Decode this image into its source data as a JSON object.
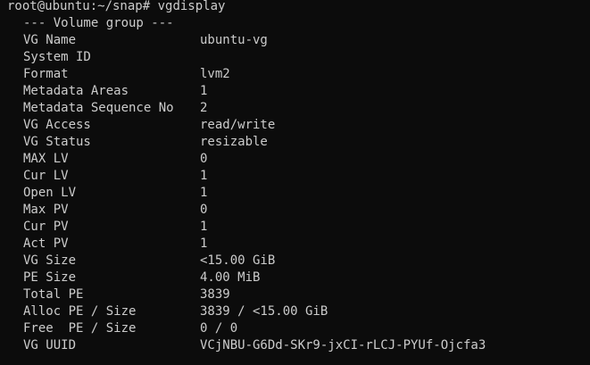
{
  "prompt": {
    "user_host_path": "root@ubuntu:~/snap#",
    "command": "vgdisplay"
  },
  "section_heading": "--- Volume group ---",
  "fields": [
    {
      "key": "VG Name",
      "value": "ubuntu-vg"
    },
    {
      "key": "System ID",
      "value": ""
    },
    {
      "key": "Format",
      "value": "lvm2"
    },
    {
      "key": "Metadata Areas",
      "value": "1"
    },
    {
      "key": "Metadata Sequence No",
      "value": "2"
    },
    {
      "key": "VG Access",
      "value": "read/write"
    },
    {
      "key": "VG Status",
      "value": "resizable"
    },
    {
      "key": "MAX LV",
      "value": "0"
    },
    {
      "key": "Cur LV",
      "value": "1"
    },
    {
      "key": "Open LV",
      "value": "1"
    },
    {
      "key": "Max PV",
      "value": "0"
    },
    {
      "key": "Cur PV",
      "value": "1"
    },
    {
      "key": "Act PV",
      "value": "1"
    },
    {
      "key": "VG Size",
      "value": "<15.00 GiB"
    },
    {
      "key": "PE Size",
      "value": "4.00 MiB"
    },
    {
      "key": "Total PE",
      "value": "3839"
    },
    {
      "key": "Alloc PE / Size",
      "value": "3839 / <15.00 GiB"
    },
    {
      "key": "Free  PE / Size",
      "value": "0 / 0"
    },
    {
      "key": "VG UUID",
      "value": "VCjNBU-G6Dd-SKr9-jxCI-rLCJ-PYUf-Ojcfa3"
    }
  ]
}
